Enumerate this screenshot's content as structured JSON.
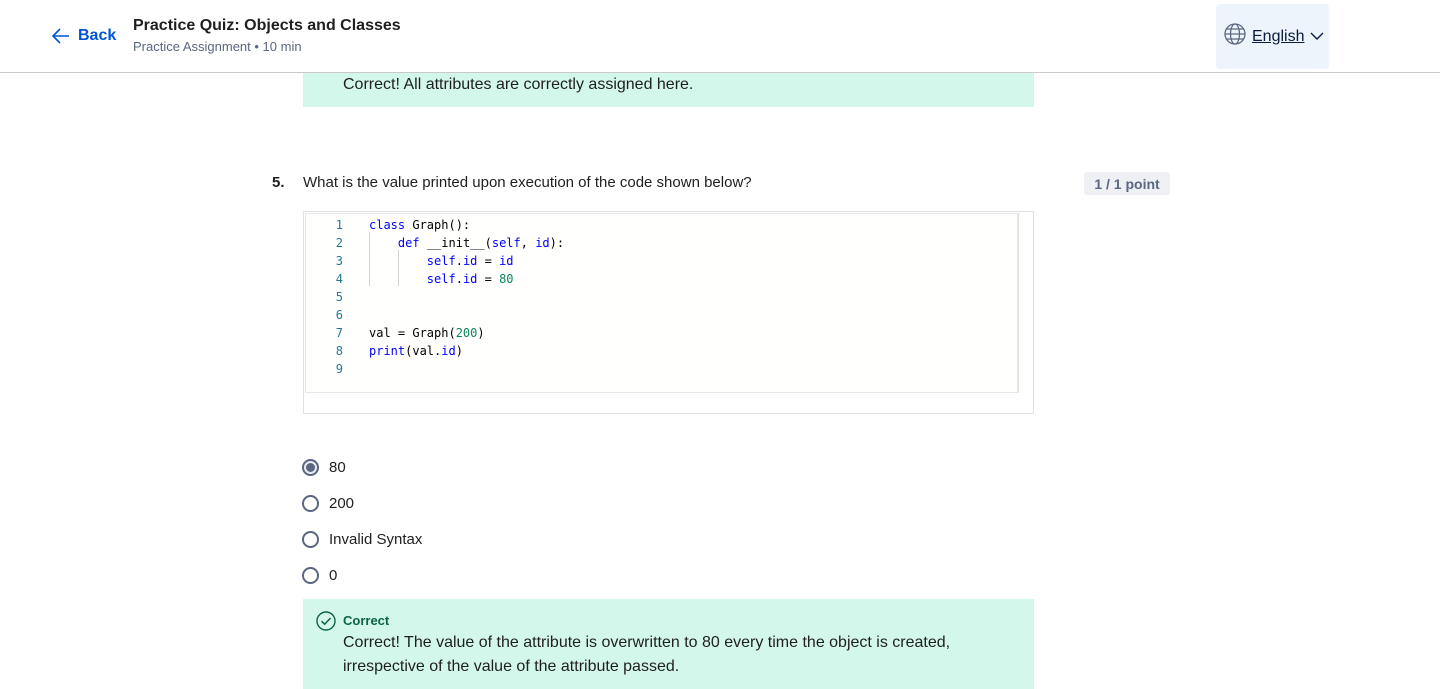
{
  "header": {
    "back_label": "Back",
    "title": "Practice Quiz: Objects and Classes",
    "subtitle": "Practice Assignment • 10 min",
    "language": "English"
  },
  "previous_feedback": {
    "text": "Correct! All attributes are correctly assigned here."
  },
  "question": {
    "number": "5.",
    "text": "What is the value printed upon execution of the code shown below?",
    "points": "1 / 1 point",
    "code_lines": [
      {
        "n": "1"
      },
      {
        "n": "2"
      },
      {
        "n": "3"
      },
      {
        "n": "4"
      },
      {
        "n": "5"
      },
      {
        "n": "6"
      },
      {
        "n": "7"
      },
      {
        "n": "8"
      },
      {
        "n": "9"
      }
    ],
    "code_text": [
      "class Graph():",
      "    def __init__(self, id):",
      "        self.id = id",
      "        self.id = 80",
      "",
      "",
      "val = Graph(200)",
      "print(val.id)",
      ""
    ],
    "options": [
      {
        "label": "80",
        "selected": true
      },
      {
        "label": "200",
        "selected": false
      },
      {
        "label": "Invalid Syntax",
        "selected": false
      },
      {
        "label": "0",
        "selected": false
      }
    ]
  },
  "feedback": {
    "status": "Correct",
    "text": "Correct! The value of the attribute is overwritten to 80 every time the object is created, irrespective of the value of the attribute passed."
  },
  "colors": {
    "accent": "#0056d2",
    "correct_bg": "#d4f7ec",
    "correct_text": "#0b6443"
  }
}
